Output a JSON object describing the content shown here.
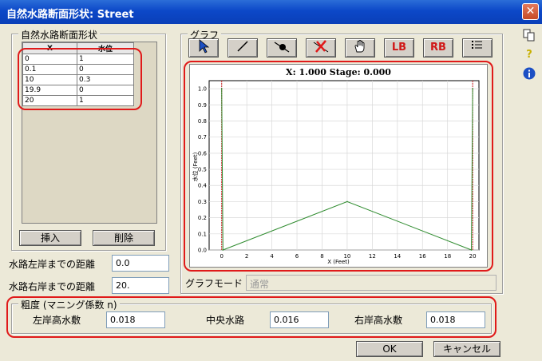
{
  "window": {
    "title": "自然水路断面形状: Street",
    "close_label": "✕"
  },
  "left_group": {
    "legend": "自然水路断面形状",
    "columns": [
      "X",
      "水位"
    ],
    "rows": [
      [
        "0",
        "1"
      ],
      [
        "0.1",
        "0"
      ],
      [
        "10",
        "0.3"
      ],
      [
        "19.9",
        "0"
      ],
      [
        "20",
        "1"
      ]
    ],
    "insert_label": "挿入",
    "delete_label": "削除"
  },
  "distance": {
    "left_label": "水路左岸までの距離",
    "left_value": "0.0",
    "right_label": "水路右岸までの距離",
    "right_value": "20."
  },
  "graph_group": {
    "legend": "グラフ",
    "tools": [
      {
        "name": "pointer-tool",
        "glyph": "↖"
      },
      {
        "name": "line-tool",
        "glyph": "╱"
      },
      {
        "name": "point-tool",
        "glyph": "●"
      },
      {
        "name": "delete-point-tool",
        "glyph": "✗"
      },
      {
        "name": "pan-tool",
        "glyph": "✋"
      },
      {
        "name": "lb-tool",
        "glyph": "LB"
      },
      {
        "name": "rb-tool",
        "glyph": "RB"
      },
      {
        "name": "list-tool",
        "glyph": "☰"
      }
    ],
    "mode_label": "グラフモード",
    "mode_value": "通常"
  },
  "chart_data": {
    "type": "line",
    "title": "X: 1.000 Stage: 0.000",
    "xlabel": "X (Feet)",
    "ylabel": "水位 (Feet)",
    "xlim": [
      -1,
      20.5
    ],
    "ylim": [
      0,
      1.05
    ],
    "xticks": [
      0,
      2,
      4,
      6,
      8,
      10,
      12,
      14,
      16,
      18,
      20
    ],
    "yticks": [
      0.0,
      0.1,
      0.2,
      0.3,
      0.4,
      0.5,
      0.6,
      0.7,
      0.8,
      0.9,
      1.0
    ],
    "series": [
      {
        "x": [
          0,
          0.1,
          10,
          19.9,
          20
        ],
        "y": [
          1,
          0,
          0.3,
          0,
          1
        ]
      }
    ],
    "bank_lines_x": [
      0,
      20
    ],
    "grid": true,
    "line_color": "#2e8b2e",
    "bank_color": "#cc2222"
  },
  "roughness": {
    "legend": "粗度 (マニング係数 n)",
    "left_label": "左岸高水敷",
    "left_value": "0.018",
    "center_label": "中央水路",
    "center_value": "0.016",
    "right_label": "右岸高水敷",
    "right_value": "0.018"
  },
  "footer": {
    "ok_label": "OK",
    "cancel_label": "キャンセル"
  },
  "side_icons": [
    "copy-icon",
    "help-icon",
    "info-icon"
  ]
}
